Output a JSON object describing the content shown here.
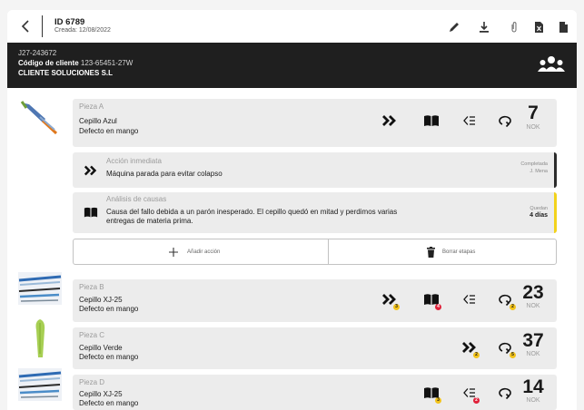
{
  "header": {
    "id": "ID 6789",
    "created": "Creada: 12/08/2022"
  },
  "client": {
    "ref": "J27-243672",
    "code_label": "Código de cliente",
    "code_value": "123-65451-27W",
    "name": "CLIENTE SOLUCIONES S.L"
  },
  "pieces": [
    {
      "label": "Pieza A",
      "name": "Cepillo Azul",
      "defect": "Defecto en mango",
      "count": "7",
      "status": "NOK"
    },
    {
      "label": "Pieza B",
      "name": "Cepillo XJ-25",
      "defect": "Defecto en mango",
      "count": "23",
      "status": "NOK",
      "badges": {
        "immediate": "3",
        "analysis": "4",
        "followup": "2"
      }
    },
    {
      "label": "Pieza C",
      "name": "Cepillo Verde",
      "defect": "Defecto en mango",
      "count": "37",
      "status": "NOK",
      "badges": {
        "immediate": "2",
        "followup": "5"
      }
    },
    {
      "label": "Pieza D",
      "name": "Cepillo XJ-25",
      "defect": "Defecto en mango",
      "count": "14",
      "status": "NOK",
      "badges": {
        "analysis": "3",
        "corrective": "2"
      }
    }
  ],
  "actions": [
    {
      "title": "Acción inmediata",
      "text": "Máquina parada para evitar colapso",
      "status": "Completada",
      "owner": "J. Mena",
      "accent": "#2b2b2b"
    },
    {
      "title": "Análisis de causas",
      "text_1": "Causa del fallo debida a un parón inesperado. El cepillo quedó en mitad y perdimos varias",
      "text_2": "entregas de materia prima.",
      "remaining_label": "Quedan",
      "remaining_value": "4 días",
      "accent": "#f2d21b"
    }
  ],
  "buttons": {
    "add_action": "Añadir acción",
    "delete_stages": "Borrar etapas"
  },
  "colors": {
    "badge_yellow": "#f2c31b",
    "badge_red": "#e0213a",
    "dark_band": "#1f1f1f",
    "row_bg": "#ececec"
  }
}
